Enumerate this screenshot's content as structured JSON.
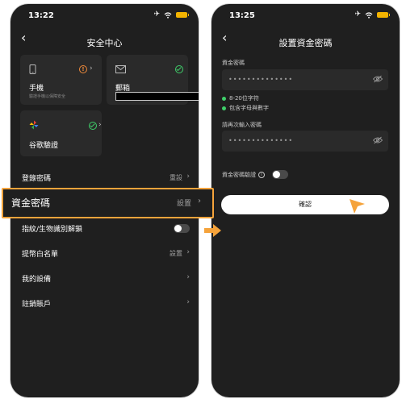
{
  "left": {
    "status": {
      "time": "13:22"
    },
    "nav": {
      "title": "安全中心"
    },
    "cards": {
      "phone": {
        "title": "手機",
        "subtitle": "驗證手機以保障安全"
      },
      "email": {
        "title": "郵箱"
      },
      "google": {
        "title": "谷歌驗證"
      }
    },
    "menu": [
      {
        "label": "登錄密碼",
        "value": "重設"
      },
      {
        "label": "資金密碼",
        "value": "設置"
      },
      {
        "label": "指紋/生物識別解鎖",
        "value": ""
      },
      {
        "label": "提幣白名單",
        "value": "設置"
      },
      {
        "label": "我的設備",
        "value": ""
      },
      {
        "label": "註銷賬戶",
        "value": ""
      }
    ]
  },
  "right": {
    "status": {
      "time": "13:25"
    },
    "nav": {
      "title": "設置資金密碼"
    },
    "form": {
      "fund_password_label": "資金密碼",
      "fund_password_value": "••••••••••••••",
      "rule_length": "8-20位字符",
      "rule_chars": "包含字母與數字",
      "confirm_label": "請再次輸入密碼",
      "confirm_value": "••••••••••••••",
      "verify_label": "資金密碼驗證",
      "confirm_button": "確認"
    }
  },
  "colors": {
    "highlight": "#f5a33b",
    "success": "#3fcf6a",
    "warning": "#f08a3a",
    "background": "#1f1f1f"
  },
  "icons": {
    "phone_card": "mobile-phone-icon",
    "email_card": "envelope-icon",
    "google_card": "google-pinwheel-icon",
    "password_visibility": "eye-off-icon"
  }
}
